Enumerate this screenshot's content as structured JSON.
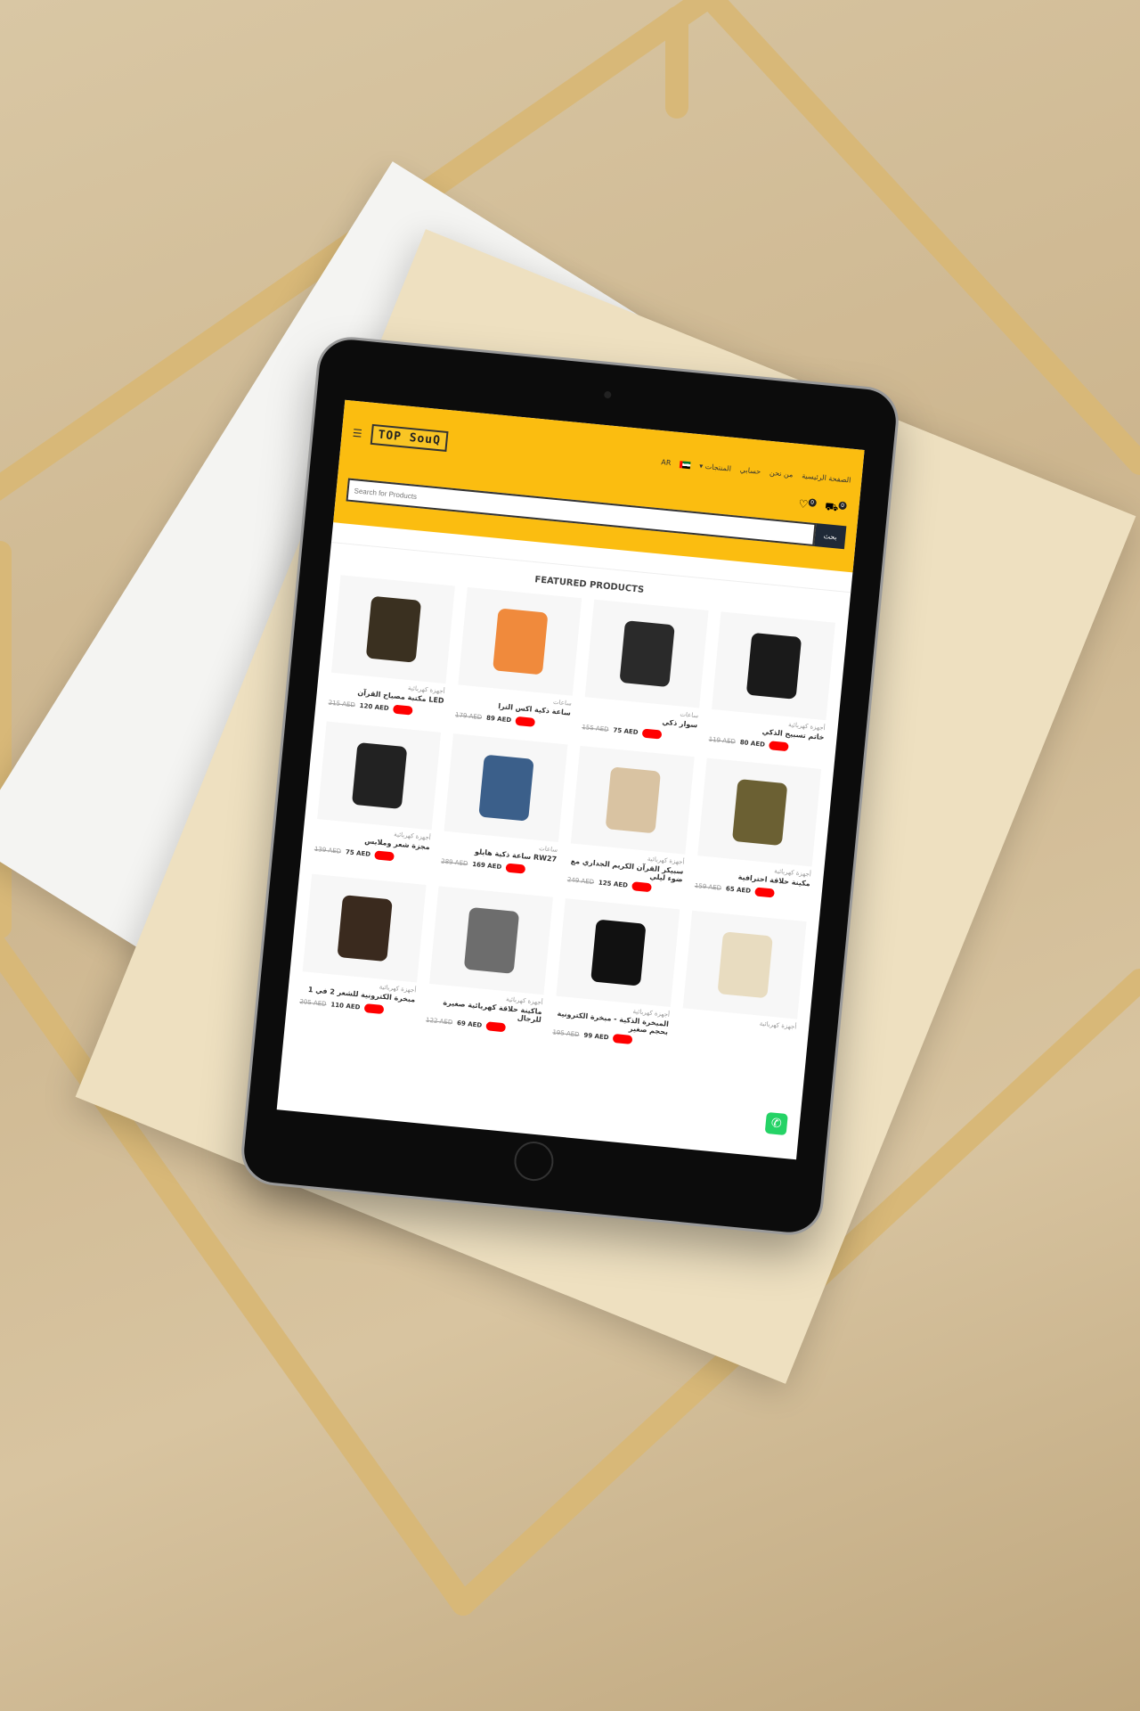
{
  "header": {
    "logo": "TOP SouQ",
    "nav": [
      "الصفحة الرئيسية",
      "من نحن",
      "حسابي",
      "المنتجات ▾"
    ],
    "lang": "AR",
    "search_placeholder": "Search for Products",
    "search_button": "بحث",
    "wishlist_count": "0",
    "cart_count": "0",
    "menu_icon": "☰"
  },
  "section_title": "FEATURED PRODUCTS",
  "products": [
    {
      "cat": "أجهزة كهربائية",
      "name": "LED مكتبة مصباح القرآن",
      "old": "215 AED",
      "new": "120 AED",
      "color": "#3a3020"
    },
    {
      "cat": "ساعات",
      "name": "ساعة ذكية اكس الترا",
      "old": "179 AED",
      "new": "89 AED",
      "color": "#f08a3c"
    },
    {
      "cat": "ساعات",
      "name": "سوار ذكي",
      "old": "155 AED",
      "new": "75 AED",
      "color": "#2a2a2a"
    },
    {
      "cat": "أجهزة كهربائية",
      "name": "خاتم تسبيح الذكي",
      "old": "119 AED",
      "new": "80 AED",
      "color": "#1a1a1a"
    },
    {
      "cat": "أجهزة كهربائية",
      "name": "مجزة شعر وملابس",
      "old": "139 AED",
      "new": "75 AED",
      "color": "#222"
    },
    {
      "cat": "ساعات",
      "name": "RW27 ساعة ذكية هايلو",
      "old": "289 AED",
      "new": "169 AED",
      "color": "#3b5f8a"
    },
    {
      "cat": "أجهزة كهربائية",
      "name": "سبيكر القرآن الكريم الجداري مع ضوء ليلي",
      "old": "249 AED",
      "new": "125 AED",
      "color": "#d9c3a2"
    },
    {
      "cat": "أجهزة كهربائية",
      "name": "مكينة حلاقة احترافية",
      "old": "159 AED",
      "new": "65 AED",
      "color": "#6b6033"
    },
    {
      "cat": "أجهزة كهربائية",
      "name": "مبخرة الكترونية للشعر 2 في 1",
      "old": "205 AED",
      "new": "110 AED",
      "color": "#3a2a1e"
    },
    {
      "cat": "أجهزة كهربائية",
      "name": "ماكينة حلاقة كهربائية صغيرة للرجال",
      "old": "122 AED",
      "new": "69 AED",
      "color": "#6d6d6d"
    },
    {
      "cat": "أجهزة كهربائية",
      "name": "المبخرة الذكية - مبخرة الكترونية بحجم صغير",
      "old": "195 AED",
      "new": "99 AED",
      "color": "#111"
    },
    {
      "cat": "أجهزة كهربائية",
      "color": "#e8dcc0"
    }
  ]
}
